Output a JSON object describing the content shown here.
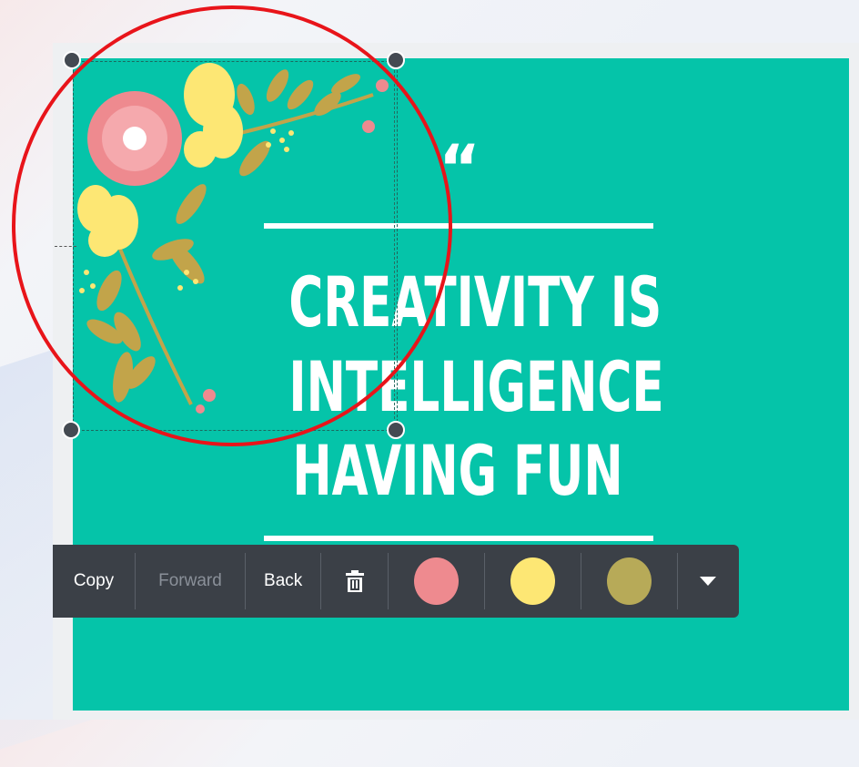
{
  "canvas": {
    "background_color": "#05c4a9",
    "quote_mark": "“",
    "quote_lines": [
      "CREATIVITY IS",
      "INTELLIGENCE",
      "HAVING FUN"
    ],
    "selected_element": "flower-illustration"
  },
  "annotation": {
    "shape": "circle",
    "color": "#e8141a"
  },
  "toolbar": {
    "copy_label": "Copy",
    "forward_label": "Forward",
    "back_label": "Back",
    "delete_icon": "trash-icon",
    "more_icon": "chevron-down-icon",
    "swatches": [
      "#ee8a8f",
      "#fde774",
      "#b7aa58"
    ]
  }
}
